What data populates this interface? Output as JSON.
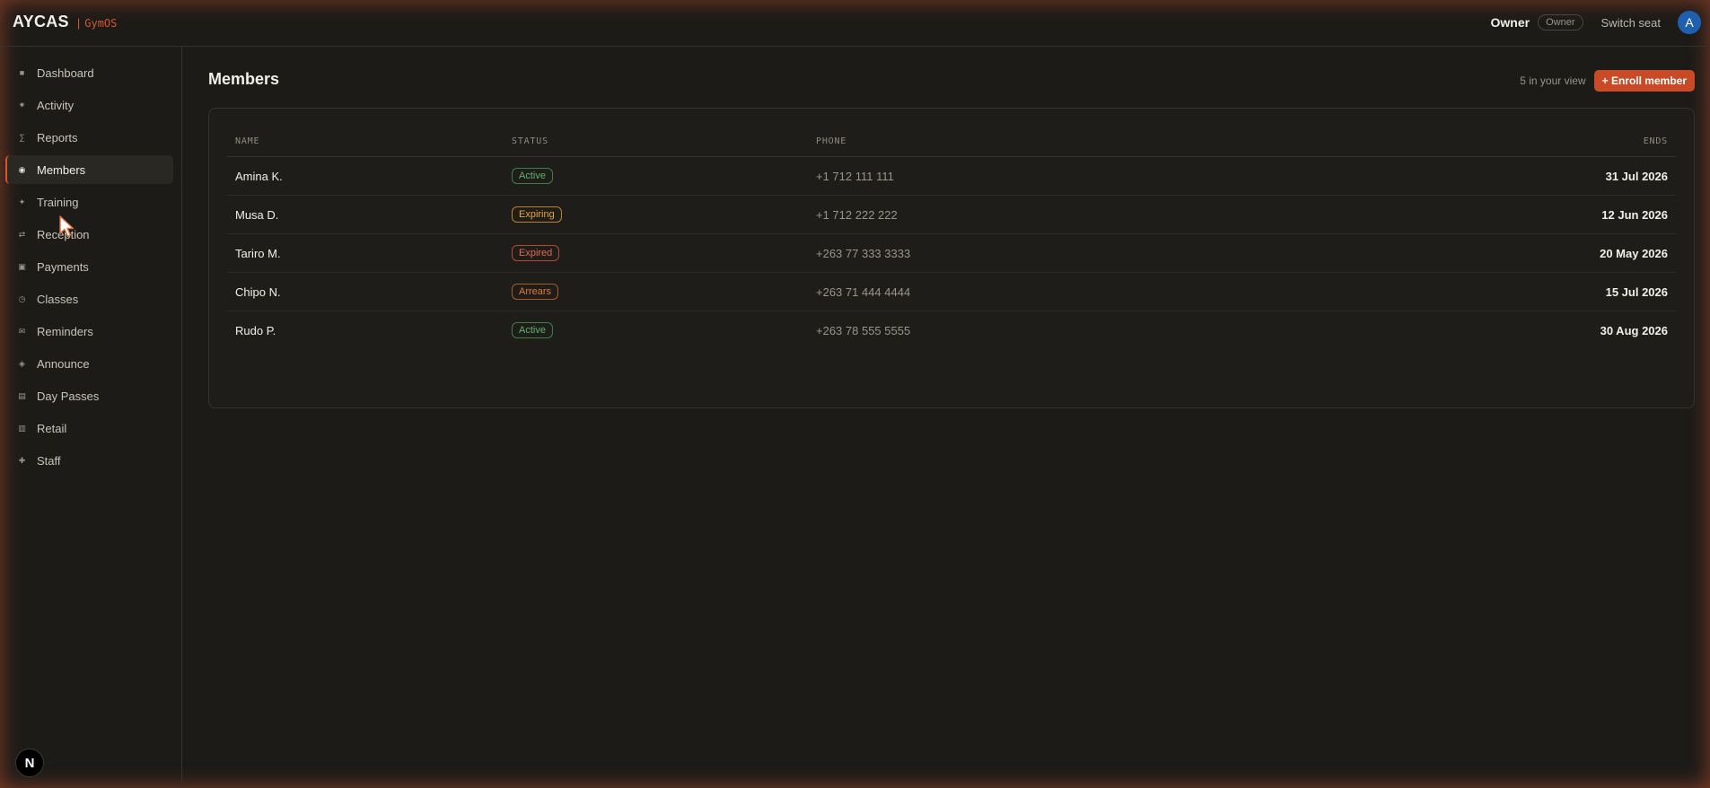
{
  "brand": {
    "name": "AYCAS",
    "separator": "|",
    "product": "GymOS"
  },
  "topbar": {
    "role": "Owner",
    "role_badge": "Owner",
    "switch_seat": "Switch seat",
    "avatar_initial": "A"
  },
  "sidebar": {
    "items": [
      {
        "label": "Dashboard",
        "icon": "grid-icon",
        "glyph": "■"
      },
      {
        "label": "Activity",
        "icon": "pulse-icon",
        "glyph": "✷"
      },
      {
        "label": "Reports",
        "icon": "sigma-icon",
        "glyph": "∑"
      },
      {
        "label": "Members",
        "icon": "target-icon",
        "glyph": "◉",
        "active": true
      },
      {
        "label": "Training",
        "icon": "sparkle-icon",
        "glyph": "✦"
      },
      {
        "label": "Reception",
        "icon": "swap-icon",
        "glyph": "⇄"
      },
      {
        "label": "Payments",
        "icon": "card-icon",
        "glyph": "▣"
      },
      {
        "label": "Classes",
        "icon": "clock-icon",
        "glyph": "◷"
      },
      {
        "label": "Reminders",
        "icon": "mail-icon",
        "glyph": "✉"
      },
      {
        "label": "Announce",
        "icon": "diamond-icon",
        "glyph": "◈"
      },
      {
        "label": "Day Passes",
        "icon": "list-icon",
        "glyph": "▤"
      },
      {
        "label": "Retail",
        "icon": "shop-icon",
        "glyph": "▥"
      },
      {
        "label": "Staff",
        "icon": "plus-icon",
        "glyph": "✚"
      }
    ],
    "bottom_badge": "N"
  },
  "main": {
    "title": "Members",
    "count_text": "5 in your view",
    "enroll_button": "+ Enroll member",
    "table": {
      "headers": {
        "name": "NAME",
        "status": "STATUS",
        "phone": "PHONE",
        "ends": "ENDS"
      },
      "rows": [
        {
          "name": "Amina K.",
          "status": "Active",
          "status_kind": "active",
          "phone": "+1 712 111 111",
          "ends": "31 Jul 2026"
        },
        {
          "name": "Musa D.",
          "status": "Expiring",
          "status_kind": "expiring",
          "phone": "+1 712 222 222",
          "ends": "12 Jun 2026"
        },
        {
          "name": "Tariro M.",
          "status": "Expired",
          "status_kind": "expired",
          "phone": "+263 77 333 3333",
          "ends": "20 May 2026"
        },
        {
          "name": "Chipo N.",
          "status": "Arrears",
          "status_kind": "arrears",
          "phone": "+263 71 444 4444",
          "ends": "15 Jul 2026"
        },
        {
          "name": "Rudo P.",
          "status": "Active",
          "status_kind": "active",
          "phone": "+263 78 555 5555",
          "ends": "30 Aug 2026"
        }
      ]
    }
  },
  "colors": {
    "accent": "#d9552e",
    "button": "#c94a26",
    "avatar": "#1f5fb0",
    "background": "#1c1b18"
  }
}
